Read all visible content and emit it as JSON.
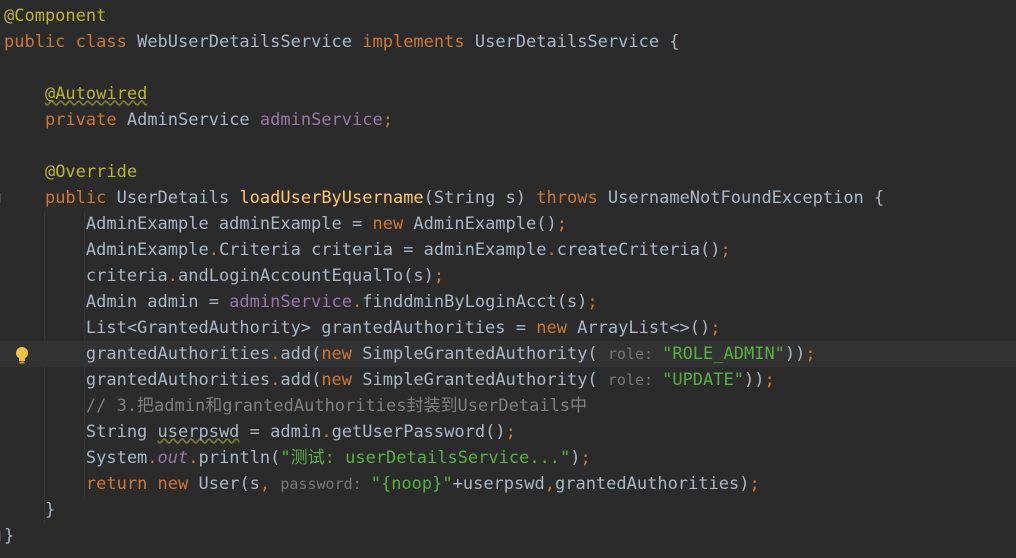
{
  "editor": {
    "lines": [
      {
        "tokens": [
          {
            "t": "@Component",
            "c": "ann"
          }
        ]
      },
      {
        "tokens": [
          {
            "t": "public ",
            "c": "kw"
          },
          {
            "t": "class ",
            "c": "kw"
          },
          {
            "t": "WebUserDetailsService ",
            "c": ""
          },
          {
            "t": "implements ",
            "c": "kw"
          },
          {
            "t": "UserDetailsService {",
            "c": ""
          }
        ]
      },
      {
        "tokens": []
      },
      {
        "tokens": [
          {
            "t": "    ",
            "c": ""
          },
          {
            "t": "@Autowired",
            "c": "ann squiggle"
          }
        ]
      },
      {
        "tokens": [
          {
            "t": "    ",
            "c": ""
          },
          {
            "t": "private ",
            "c": "kw"
          },
          {
            "t": "AdminService ",
            "c": ""
          },
          {
            "t": "adminService",
            "c": "field"
          },
          {
            "t": ";",
            "c": "kw"
          }
        ]
      },
      {
        "tokens": []
      },
      {
        "tokens": [
          {
            "t": "    ",
            "c": ""
          },
          {
            "t": "@Override",
            "c": "ann"
          }
        ]
      },
      {
        "tokens": [
          {
            "t": "    ",
            "c": ""
          },
          {
            "t": "public ",
            "c": "kw"
          },
          {
            "t": "UserDetails ",
            "c": ""
          },
          {
            "t": "loadUserByUsername",
            "c": "fn"
          },
          {
            "t": "(String s) ",
            "c": ""
          },
          {
            "t": "throws ",
            "c": "kw"
          },
          {
            "t": "UsernameNotFoundException {",
            "c": ""
          }
        ]
      },
      {
        "tokens": [
          {
            "t": "        AdminExample adminExample = ",
            "c": ""
          },
          {
            "t": "new ",
            "c": "kw"
          },
          {
            "t": "AdminExample()",
            "c": ""
          },
          {
            "t": ";",
            "c": "kw"
          }
        ]
      },
      {
        "tokens": [
          {
            "t": "        AdminExample",
            "c": ""
          },
          {
            "t": ".",
            "c": "kw"
          },
          {
            "t": "Criteria criteria = adminExample",
            "c": ""
          },
          {
            "t": ".",
            "c": "kw"
          },
          {
            "t": "createCriteria()",
            "c": ""
          },
          {
            "t": ";",
            "c": "kw"
          }
        ]
      },
      {
        "tokens": [
          {
            "t": "        criteria",
            "c": ""
          },
          {
            "t": ".",
            "c": "kw"
          },
          {
            "t": "andLoginAccountEqualTo(s)",
            "c": ""
          },
          {
            "t": ";",
            "c": "kw"
          }
        ]
      },
      {
        "tokens": [
          {
            "t": "        Admin admin = ",
            "c": ""
          },
          {
            "t": "adminService",
            "c": "field"
          },
          {
            "t": ".",
            "c": "kw"
          },
          {
            "t": "finddminByLoginAcct(s)",
            "c": ""
          },
          {
            "t": ";",
            "c": "kw"
          }
        ]
      },
      {
        "tokens": [
          {
            "t": "        List<GrantedAuthority> grantedAuthorities = ",
            "c": ""
          },
          {
            "t": "new ",
            "c": "kw"
          },
          {
            "t": "ArrayList<>()",
            "c": ""
          },
          {
            "t": ";",
            "c": "kw"
          }
        ]
      },
      {
        "tokens": [
          {
            "t": "        grantedAuthorities",
            "c": ""
          },
          {
            "t": ".",
            "c": "kw"
          },
          {
            "t": "add(",
            "c": ""
          },
          {
            "t": "new ",
            "c": "kw"
          },
          {
            "t": "SimpleGrantedAuthority( ",
            "c": ""
          },
          {
            "t": "role: ",
            "c": "hint"
          },
          {
            "t": "\"ROLE_ADMIN\"",
            "c": "str-green"
          },
          {
            "t": "))",
            "c": ""
          },
          {
            "t": ";",
            "c": "kw"
          }
        ],
        "current": true
      },
      {
        "tokens": [
          {
            "t": "        grantedAuthorities",
            "c": ""
          },
          {
            "t": ".",
            "c": "kw"
          },
          {
            "t": "add(",
            "c": ""
          },
          {
            "t": "new ",
            "c": "kw"
          },
          {
            "t": "SimpleGrantedAuthority( ",
            "c": ""
          },
          {
            "t": "role: ",
            "c": "hint"
          },
          {
            "t": "\"UPDATE\"",
            "c": "str-green"
          },
          {
            "t": "))",
            "c": ""
          },
          {
            "t": ";",
            "c": "kw"
          }
        ]
      },
      {
        "tokens": [
          {
            "t": "        // 3.把admin和grantedAuthorities封装到UserDetails中",
            "c": "comment"
          }
        ]
      },
      {
        "tokens": [
          {
            "t": "        String ",
            "c": ""
          },
          {
            "t": "userpswd",
            "c": "squiggle"
          },
          {
            "t": " = admin",
            "c": ""
          },
          {
            "t": ".",
            "c": "kw"
          },
          {
            "t": "getUserPassword()",
            "c": ""
          },
          {
            "t": ";",
            "c": "kw"
          }
        ]
      },
      {
        "tokens": [
          {
            "t": "        System",
            "c": ""
          },
          {
            "t": ".",
            "c": "kw"
          },
          {
            "t": "out",
            "c": "static"
          },
          {
            "t": ".",
            "c": "kw"
          },
          {
            "t": "println(",
            "c": ""
          },
          {
            "t": "\"测试: userDetailsService...\"",
            "c": "str-green"
          },
          {
            "t": ")",
            "c": ""
          },
          {
            "t": ";",
            "c": "kw"
          }
        ]
      },
      {
        "tokens": [
          {
            "t": "        ",
            "c": ""
          },
          {
            "t": "return ",
            "c": "kw"
          },
          {
            "t": "new ",
            "c": "kw"
          },
          {
            "t": "User(s",
            "c": ""
          },
          {
            "t": ", ",
            "c": "kw"
          },
          {
            "t": "password: ",
            "c": "hint"
          },
          {
            "t": "\"{noop}\"",
            "c": "str-green"
          },
          {
            "t": "+userpswd",
            "c": ""
          },
          {
            "t": ",",
            "c": "kw"
          },
          {
            "t": "grantedAuthorities)",
            "c": ""
          },
          {
            "t": ";",
            "c": "kw"
          }
        ]
      },
      {
        "tokens": [
          {
            "t": "    }",
            "c": ""
          }
        ]
      },
      {
        "tokens": [
          {
            "t": "}",
            "c": ""
          }
        ]
      }
    ],
    "bulb_icon": "lightbulb-icon",
    "colors": {
      "background": "#2b2b2b",
      "keyword": "#cc7832",
      "annotation": "#bbb529",
      "method": "#ffc66d",
      "field": "#9876aa",
      "string": "#54b33e",
      "comment": "#808080",
      "text": "#a9b7c6"
    }
  }
}
